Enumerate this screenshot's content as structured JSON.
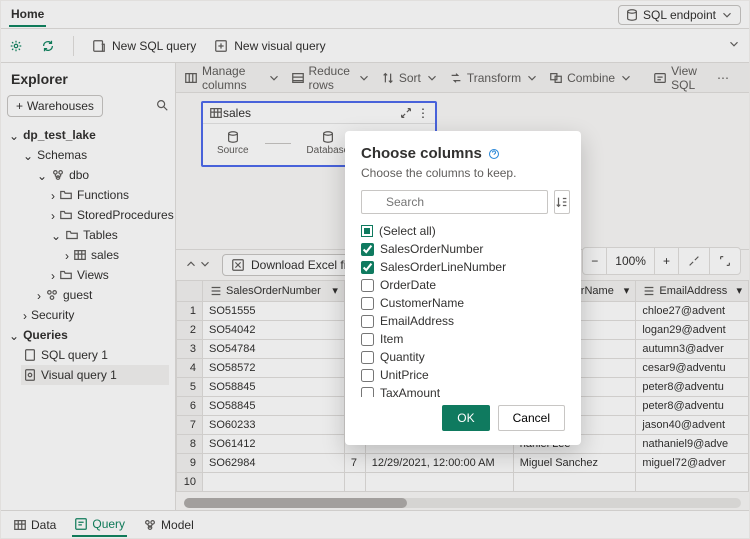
{
  "header": {
    "tab_home": "Home",
    "endpoint_label": "SQL endpoint"
  },
  "toolbar": {
    "new_sql": "New SQL query",
    "new_visual": "New visual query"
  },
  "explorer": {
    "title": "Explorer",
    "warehouses_btn": "Warehouses",
    "tree": {
      "lake": "dp_test_lake",
      "schemas": "Schemas",
      "dbo": "dbo",
      "functions": "Functions",
      "sp": "StoredProcedures",
      "tables": "Tables",
      "sales": "sales",
      "views": "Views",
      "guest": "guest",
      "security": "Security",
      "queries": "Queries",
      "sql_q1": "SQL query 1",
      "visual_q1": "Visual query 1"
    }
  },
  "query_toolbar": {
    "manage_cols": "Manage columns",
    "reduce_rows": "Reduce rows",
    "sort": "Sort",
    "transform": "Transform",
    "combine": "Combine",
    "view_sql": "View SQL"
  },
  "design": {
    "node_title": "sales",
    "steps": [
      "Source",
      "Database",
      ""
    ]
  },
  "zoom": {
    "pct": "100%"
  },
  "grid": {
    "download": "Download Excel file",
    "headers": [
      "",
      "SalesOrderNumber",
      "",
      "",
      "CustomerName",
      "EmailAddress"
    ],
    "rows": [
      {
        "n": "1",
        "so": "SO51555",
        "ln": "",
        "dt": "",
        "cust": "oe Garcia",
        "em": "chloe27@advent"
      },
      {
        "n": "2",
        "so": "SO54042",
        "ln": "",
        "dt": "",
        "cust": "an Collins",
        "em": "logan29@advent"
      },
      {
        "n": "3",
        "so": "SO54784",
        "ln": "",
        "dt": "",
        "cust": "umn Li",
        "em": "autumn3@adver"
      },
      {
        "n": "4",
        "so": "SO58572",
        "ln": "",
        "dt": "",
        "cust": "ar Sara",
        "em": "cesar9@adventu"
      },
      {
        "n": "5",
        "so": "SO58845",
        "ln": "",
        "dt": "",
        "cust": "er She",
        "em": "peter8@adventu"
      },
      {
        "n": "6",
        "so": "SO58845",
        "ln": "",
        "dt": "",
        "cust": "er She",
        "em": "peter8@adventu"
      },
      {
        "n": "7",
        "so": "SO60233",
        "ln": "",
        "dt": "",
        "cust": "on Mitchell",
        "em": "jason40@advent"
      },
      {
        "n": "8",
        "so": "SO61412",
        "ln": "",
        "dt": "",
        "cust": "haniel Lee",
        "em": "nathaniel9@adve"
      },
      {
        "n": "9",
        "so": "SO62984",
        "ln": "7",
        "dt": "12/29/2021, 12:00:00 AM",
        "cust": "Miguel Sanchez",
        "em": "miguel72@adver"
      },
      {
        "n": "10",
        "so": "",
        "ln": "",
        "dt": "",
        "cust": "",
        "em": ""
      }
    ]
  },
  "bottom_tabs": {
    "data": "Data",
    "query": "Query",
    "model": "Model"
  },
  "modal": {
    "title": "Choose columns",
    "subtitle": "Choose the columns to keep.",
    "search_placeholder": "Search",
    "select_all": "(Select all)",
    "columns": [
      {
        "label": "SalesOrderNumber",
        "checked": true
      },
      {
        "label": "SalesOrderLineNumber",
        "checked": true
      },
      {
        "label": "OrderDate",
        "checked": false
      },
      {
        "label": "CustomerName",
        "checked": false
      },
      {
        "label": "EmailAddress",
        "checked": false
      },
      {
        "label": "Item",
        "checked": false
      },
      {
        "label": "Quantity",
        "checked": false
      },
      {
        "label": "UnitPrice",
        "checked": false
      },
      {
        "label": "TaxAmount",
        "checked": false
      }
    ],
    "ok": "OK",
    "cancel": "Cancel"
  }
}
